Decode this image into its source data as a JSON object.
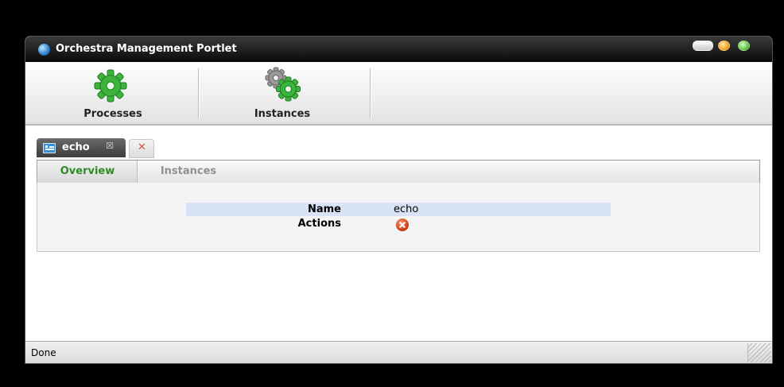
{
  "window": {
    "title": "Orchestra Management Portlet",
    "controls": [
      "minimize",
      "maximize",
      "close"
    ]
  },
  "toolbar": {
    "items": [
      {
        "label": "Processes",
        "icon": "gear-icon",
        "color": "#3cb43c"
      },
      {
        "label": "Instances",
        "icon": "gears-icon",
        "color": "#3cb43c"
      }
    ]
  },
  "object_tab": {
    "label": "echo",
    "icon": "process-icon",
    "close_glyph": "☒",
    "close_all_glyph": "✕"
  },
  "subtabs": [
    {
      "label": "Overview",
      "active": true
    },
    {
      "label": "Instances",
      "active": false
    }
  ],
  "properties": {
    "name_label": "Name",
    "name_value": "echo",
    "actions_label": "Actions",
    "action_icon": "delete-icon"
  },
  "status": {
    "text": "Done"
  },
  "colors": {
    "accent_green": "#2e8a22",
    "highlight_row": "#d8e4f6",
    "delete_red": "#d0401c"
  }
}
